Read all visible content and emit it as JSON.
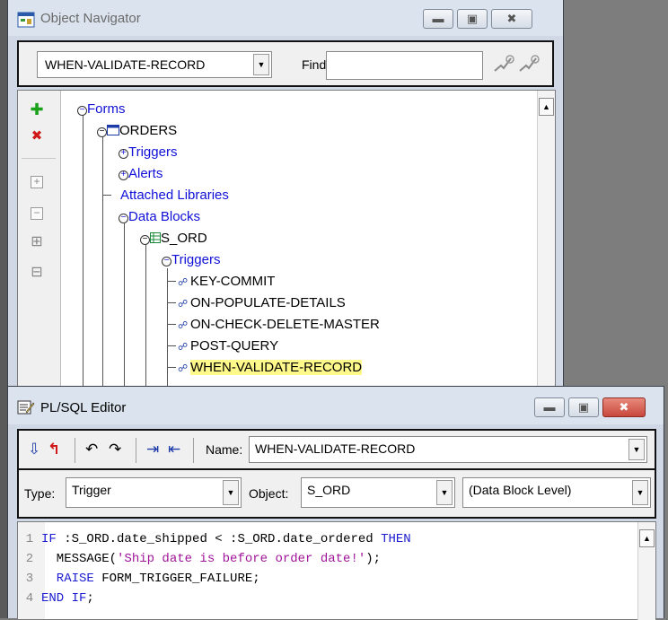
{
  "navigator": {
    "title": "Object Navigator",
    "object_combo": "WHEN-VALIDATE-RECORD",
    "find_label": "Find:",
    "find_value": "",
    "tree": {
      "forms": "Forms",
      "orders": "ORDERS",
      "triggers": "Triggers",
      "alerts": "Alerts",
      "attached_libraries": "Attached Libraries",
      "data_blocks": "Data Blocks",
      "s_ord": "S_ORD",
      "block_triggers": "Triggers",
      "items": [
        "KEY-COMMIT",
        "ON-POPULATE-DETAILS",
        "ON-CHECK-DELETE-MASTER",
        "POST-QUERY",
        "WHEN-VALIDATE-RECORD"
      ]
    }
  },
  "editor": {
    "title": "PL/SQL Editor",
    "name_label": "Name:",
    "name_value": "WHEN-VALIDATE-RECORD",
    "type_label": "Type:",
    "type_value": "Trigger",
    "object_label": "Object:",
    "object_value": "S_ORD",
    "level_value": "(Data Block Level)",
    "code": {
      "line_numbers": [
        "1",
        "2",
        "3",
        "4"
      ],
      "l1_kw1": "IF",
      "l1_mid": " :S_ORD.date_shipped < :S_ORD.date_ordered ",
      "l1_kw2": "THEN",
      "l2_pre": "  MESSAGE(",
      "l2_str": "'Ship date is before order date!'",
      "l2_post": ");",
      "l3_kw": "  RAISE",
      "l3_rest": " FORM_TRIGGER_FAILURE;",
      "l4_kw": "END IF",
      "l4_rest": ";"
    }
  },
  "colors": {
    "tree_link": "#1010d8",
    "selection": "#fff88a",
    "keyword": "#1c1cd0",
    "string": "#a0149a",
    "close_button": "#c8483c"
  }
}
